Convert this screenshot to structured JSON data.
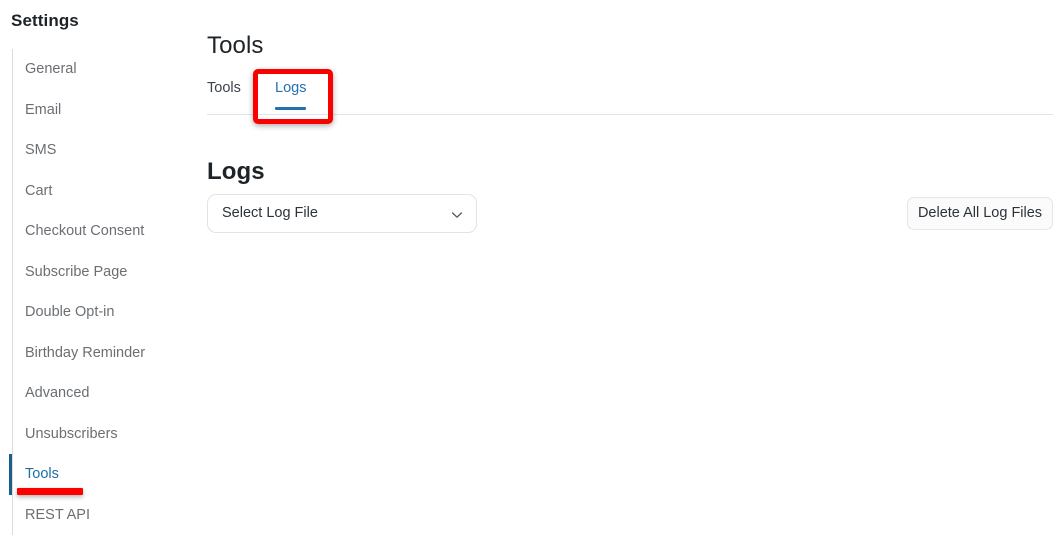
{
  "sidebar": {
    "title": "Settings",
    "items": [
      {
        "label": "General",
        "active": false
      },
      {
        "label": "Email",
        "active": false
      },
      {
        "label": "SMS",
        "active": false
      },
      {
        "label": "Cart",
        "active": false
      },
      {
        "label": "Checkout Consent",
        "active": false
      },
      {
        "label": "Subscribe Page",
        "active": false
      },
      {
        "label": "Double Opt-in",
        "active": false
      },
      {
        "label": "Birthday Reminder",
        "active": false
      },
      {
        "label": "Advanced",
        "active": false
      },
      {
        "label": "Unsubscribers",
        "active": false
      },
      {
        "label": "Tools",
        "active": true
      },
      {
        "label": "REST API",
        "active": false
      }
    ]
  },
  "main": {
    "page_title": "Tools",
    "tabs": [
      {
        "label": "Tools",
        "active": false
      },
      {
        "label": "Logs",
        "active": true
      }
    ],
    "section": {
      "heading": "Logs",
      "log_file_select": {
        "value": "Select Log File",
        "icon": "chevron-down-icon"
      },
      "delete_all_button": "Delete All Log Files"
    }
  },
  "annotations": {
    "logs_tab_highlight": "red-rectangle",
    "tools_sidebar_highlight": "red-underline",
    "color": "#fc0000"
  },
  "colors": {
    "accent_blue": "#2271b1",
    "active_nav_blue": "#1d6fa5",
    "nav_indicator_blue": "#1a5e8a",
    "text_dark": "#1d2327",
    "text_muted": "#6b6f74",
    "divider": "#e3e3ea",
    "annotation_red": "#fc0000"
  }
}
